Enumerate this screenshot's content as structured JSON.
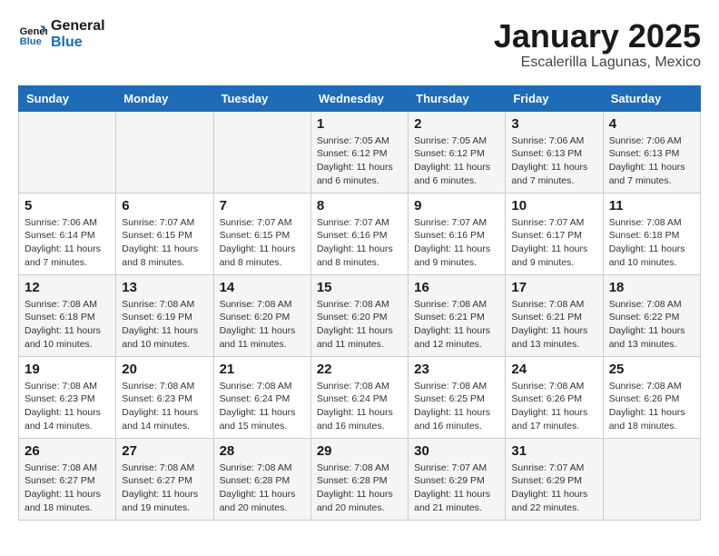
{
  "header": {
    "logo_line1": "General",
    "logo_line2": "Blue",
    "calendar_title": "January 2025",
    "calendar_subtitle": "Escalerilla Lagunas, Mexico"
  },
  "days_of_week": [
    "Sunday",
    "Monday",
    "Tuesday",
    "Wednesday",
    "Thursday",
    "Friday",
    "Saturday"
  ],
  "weeks": [
    [
      {
        "day": "",
        "info": ""
      },
      {
        "day": "",
        "info": ""
      },
      {
        "day": "",
        "info": ""
      },
      {
        "day": "1",
        "info": "Sunrise: 7:05 AM\nSunset: 6:12 PM\nDaylight: 11 hours and 6 minutes."
      },
      {
        "day": "2",
        "info": "Sunrise: 7:05 AM\nSunset: 6:12 PM\nDaylight: 11 hours and 6 minutes."
      },
      {
        "day": "3",
        "info": "Sunrise: 7:06 AM\nSunset: 6:13 PM\nDaylight: 11 hours and 7 minutes."
      },
      {
        "day": "4",
        "info": "Sunrise: 7:06 AM\nSunset: 6:13 PM\nDaylight: 11 hours and 7 minutes."
      }
    ],
    [
      {
        "day": "5",
        "info": "Sunrise: 7:06 AM\nSunset: 6:14 PM\nDaylight: 11 hours and 7 minutes."
      },
      {
        "day": "6",
        "info": "Sunrise: 7:07 AM\nSunset: 6:15 PM\nDaylight: 11 hours and 8 minutes."
      },
      {
        "day": "7",
        "info": "Sunrise: 7:07 AM\nSunset: 6:15 PM\nDaylight: 11 hours and 8 minutes."
      },
      {
        "day": "8",
        "info": "Sunrise: 7:07 AM\nSunset: 6:16 PM\nDaylight: 11 hours and 8 minutes."
      },
      {
        "day": "9",
        "info": "Sunrise: 7:07 AM\nSunset: 6:16 PM\nDaylight: 11 hours and 9 minutes."
      },
      {
        "day": "10",
        "info": "Sunrise: 7:07 AM\nSunset: 6:17 PM\nDaylight: 11 hours and 9 minutes."
      },
      {
        "day": "11",
        "info": "Sunrise: 7:08 AM\nSunset: 6:18 PM\nDaylight: 11 hours and 10 minutes."
      }
    ],
    [
      {
        "day": "12",
        "info": "Sunrise: 7:08 AM\nSunset: 6:18 PM\nDaylight: 11 hours and 10 minutes."
      },
      {
        "day": "13",
        "info": "Sunrise: 7:08 AM\nSunset: 6:19 PM\nDaylight: 11 hours and 10 minutes."
      },
      {
        "day": "14",
        "info": "Sunrise: 7:08 AM\nSunset: 6:20 PM\nDaylight: 11 hours and 11 minutes."
      },
      {
        "day": "15",
        "info": "Sunrise: 7:08 AM\nSunset: 6:20 PM\nDaylight: 11 hours and 11 minutes."
      },
      {
        "day": "16",
        "info": "Sunrise: 7:08 AM\nSunset: 6:21 PM\nDaylight: 11 hours and 12 minutes."
      },
      {
        "day": "17",
        "info": "Sunrise: 7:08 AM\nSunset: 6:21 PM\nDaylight: 11 hours and 13 minutes."
      },
      {
        "day": "18",
        "info": "Sunrise: 7:08 AM\nSunset: 6:22 PM\nDaylight: 11 hours and 13 minutes."
      }
    ],
    [
      {
        "day": "19",
        "info": "Sunrise: 7:08 AM\nSunset: 6:23 PM\nDaylight: 11 hours and 14 minutes."
      },
      {
        "day": "20",
        "info": "Sunrise: 7:08 AM\nSunset: 6:23 PM\nDaylight: 11 hours and 14 minutes."
      },
      {
        "day": "21",
        "info": "Sunrise: 7:08 AM\nSunset: 6:24 PM\nDaylight: 11 hours and 15 minutes."
      },
      {
        "day": "22",
        "info": "Sunrise: 7:08 AM\nSunset: 6:24 PM\nDaylight: 11 hours and 16 minutes."
      },
      {
        "day": "23",
        "info": "Sunrise: 7:08 AM\nSunset: 6:25 PM\nDaylight: 11 hours and 16 minutes."
      },
      {
        "day": "24",
        "info": "Sunrise: 7:08 AM\nSunset: 6:26 PM\nDaylight: 11 hours and 17 minutes."
      },
      {
        "day": "25",
        "info": "Sunrise: 7:08 AM\nSunset: 6:26 PM\nDaylight: 11 hours and 18 minutes."
      }
    ],
    [
      {
        "day": "26",
        "info": "Sunrise: 7:08 AM\nSunset: 6:27 PM\nDaylight: 11 hours and 18 minutes."
      },
      {
        "day": "27",
        "info": "Sunrise: 7:08 AM\nSunset: 6:27 PM\nDaylight: 11 hours and 19 minutes."
      },
      {
        "day": "28",
        "info": "Sunrise: 7:08 AM\nSunset: 6:28 PM\nDaylight: 11 hours and 20 minutes."
      },
      {
        "day": "29",
        "info": "Sunrise: 7:08 AM\nSunset: 6:28 PM\nDaylight: 11 hours and 20 minutes."
      },
      {
        "day": "30",
        "info": "Sunrise: 7:07 AM\nSunset: 6:29 PM\nDaylight: 11 hours and 21 minutes."
      },
      {
        "day": "31",
        "info": "Sunrise: 7:07 AM\nSunset: 6:29 PM\nDaylight: 11 hours and 22 minutes."
      },
      {
        "day": "",
        "info": ""
      }
    ]
  ]
}
